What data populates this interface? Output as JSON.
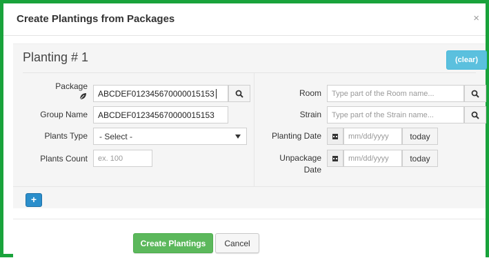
{
  "dialog": {
    "title": "Create Plantings from Packages",
    "close_label": "×"
  },
  "planting": {
    "heading": "Planting # 1",
    "clear_label": "(clear)"
  },
  "left_fields": {
    "package_label": "Package",
    "package_value": "ABCDEF012345670000015153",
    "group_name_label": "Group Name",
    "group_name_value": "ABCDEF012345670000015153",
    "plants_type_label": "Plants Type",
    "plants_type_value": "- Select -",
    "plants_count_label": "Plants Count",
    "plants_count_placeholder": "ex. 100"
  },
  "right_fields": {
    "room_label": "Room",
    "room_placeholder": "Type part of the Room name...",
    "strain_label": "Strain",
    "strain_placeholder": "Type part of the Strain name...",
    "planting_date_label": "Planting Date",
    "planting_date_placeholder": "mm/dd/yyyy",
    "unpackage_label_line1": "Unpackage",
    "unpackage_label_line2": "Date",
    "unpackage_date_placeholder": "mm/dd/yyyy",
    "today_label": "today"
  },
  "add_button_label": "+",
  "footer": {
    "create_label": "Create Plantings",
    "cancel_label": "Cancel"
  },
  "colors": {
    "frame_border": "#19a33b",
    "clear_button": "#5bc0de",
    "add_button": "#2b8ecb",
    "create_button": "#5cb85c"
  },
  "icons": [
    "close-icon",
    "leaf-icon",
    "search-icon",
    "calendar-icon",
    "dropdown-arrow-icon",
    "plus-icon"
  ]
}
